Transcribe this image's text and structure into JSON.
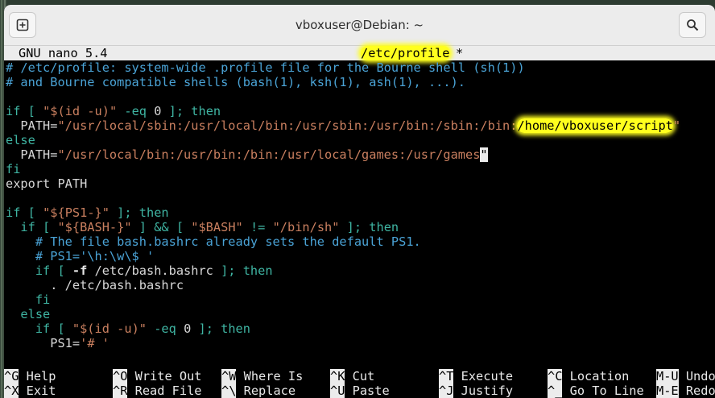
{
  "window": {
    "title": "vboxuser@Debian: ~"
  },
  "nano": {
    "version": "GNU nano 5.4",
    "filename": "/etc/profile",
    "modified_marker": "*"
  },
  "lines": [
    {
      "segments": [
        {
          "t": "# /etc/profile: system-wide .profile file for the Bourne shell (sh(1))",
          "c": "comment"
        }
      ]
    },
    {
      "segments": [
        {
          "t": "# and Bourne compatible shells (bash(1), ksh(1), ash(1), ...).",
          "c": "comment"
        }
      ]
    },
    {
      "segments": []
    },
    {
      "segments": [
        {
          "t": "if [ ",
          "c": "kw"
        },
        {
          "t": "\"$(id -u)\"",
          "c": "str"
        },
        {
          "t": " -eq ",
          "c": "kw"
        },
        {
          "t": "0",
          "c": "plain"
        },
        {
          "t": " ]; then",
          "c": "kw"
        }
      ]
    },
    {
      "segments": [
        {
          "t": "  PATH=",
          "c": "plain"
        },
        {
          "t": "\"/usr/local/sbin:/usr/local/bin:/usr/sbin:/usr/bin:/sbin:/bin:",
          "c": "str"
        },
        {
          "t": "/home/vboxuser/script",
          "c": "hl"
        },
        {
          "t": "\"",
          "c": "str"
        }
      ]
    },
    {
      "segments": [
        {
          "t": "else",
          "c": "kw"
        }
      ]
    },
    {
      "segments": [
        {
          "t": "  PATH=",
          "c": "plain"
        },
        {
          "t": "\"/usr/local/bin:/usr/bin:/bin:/usr/local/games:/usr/games",
          "c": "str"
        },
        {
          "t": "\"",
          "c": "cursor"
        }
      ]
    },
    {
      "segments": [
        {
          "t": "fi",
          "c": "kw"
        }
      ]
    },
    {
      "segments": [
        {
          "t": "export PATH",
          "c": "plain"
        }
      ]
    },
    {
      "segments": []
    },
    {
      "segments": [
        {
          "t": "if [ ",
          "c": "kw"
        },
        {
          "t": "\"${PS1-}\"",
          "c": "str"
        },
        {
          "t": " ]; then",
          "c": "kw"
        }
      ]
    },
    {
      "segments": [
        {
          "t": "  if [ ",
          "c": "kw"
        },
        {
          "t": "\"${BASH-}\"",
          "c": "str"
        },
        {
          "t": " ] && [ ",
          "c": "kw"
        },
        {
          "t": "\"$BASH\"",
          "c": "str"
        },
        {
          "t": " != ",
          "c": "kw"
        },
        {
          "t": "\"/bin/sh\"",
          "c": "str"
        },
        {
          "t": " ]; then",
          "c": "kw"
        }
      ]
    },
    {
      "segments": [
        {
          "t": "    # The file bash.bashrc already sets the default PS1.",
          "c": "comment"
        }
      ]
    },
    {
      "segments": [
        {
          "t": "    # PS1='\\h:\\w\\$ '",
          "c": "comment"
        }
      ]
    },
    {
      "segments": [
        {
          "t": "    if [ ",
          "c": "kw"
        },
        {
          "t": "-f",
          "c": "bold"
        },
        {
          "t": " /etc/bash.bashrc",
          "c": "plain"
        },
        {
          "t": " ]; then",
          "c": "kw"
        }
      ]
    },
    {
      "segments": [
        {
          "t": "      . /etc/bash.bashrc",
          "c": "plain"
        }
      ]
    },
    {
      "segments": [
        {
          "t": "    fi",
          "c": "kw"
        }
      ]
    },
    {
      "segments": [
        {
          "t": "  else",
          "c": "kw"
        }
      ]
    },
    {
      "segments": [
        {
          "t": "    if [ ",
          "c": "kw"
        },
        {
          "t": "\"$(id -u)\"",
          "c": "str"
        },
        {
          "t": " -eq ",
          "c": "kw"
        },
        {
          "t": "0",
          "c": "plain"
        },
        {
          "t": " ]; then",
          "c": "kw"
        }
      ]
    },
    {
      "segments": [
        {
          "t": "      PS1=",
          "c": "plain"
        },
        {
          "t": "'# '",
          "c": "str"
        }
      ]
    }
  ],
  "shortcuts": {
    "row1": [
      {
        "key": "^G",
        "label": "Help"
      },
      {
        "key": "^O",
        "label": "Write Out"
      },
      {
        "key": "^W",
        "label": "Where Is"
      },
      {
        "key": "^K",
        "label": "Cut"
      },
      {
        "key": "^T",
        "label": "Execute"
      },
      {
        "key": "^C",
        "label": "Location"
      },
      {
        "key": "M-U",
        "label": "Undo"
      }
    ],
    "row2": [
      {
        "key": "^X",
        "label": "Exit"
      },
      {
        "key": "^R",
        "label": "Read File"
      },
      {
        "key": "^\\",
        "label": "Replace"
      },
      {
        "key": "^U",
        "label": "Paste"
      },
      {
        "key": "^J",
        "label": "Justify"
      },
      {
        "key": "^_",
        "label": "Go To Line"
      },
      {
        "key": "M-E",
        "label": "Redo"
      }
    ]
  },
  "colors": {
    "comment": "#4aa3d6",
    "string": "#c97f5f",
    "keyword": "#3fb5a3",
    "highlight": "#ffff1e"
  },
  "icons": {
    "new_tab": "new-tab-icon",
    "search": "search-icon"
  }
}
